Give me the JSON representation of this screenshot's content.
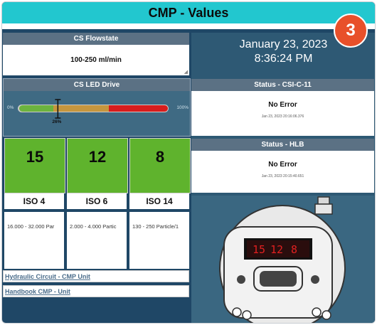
{
  "title": "CMP - Values",
  "badge": "3",
  "flowstate": {
    "header": "CS Flowstate",
    "value": "100-250 ml/min"
  },
  "led_drive": {
    "header": "CS LED Drive",
    "min_label": "0%",
    "max_label": "100%",
    "value_label": "26%",
    "value_fraction": 0.26
  },
  "datetime": {
    "date": "January 23, 2023",
    "time": "8:36:24 PM"
  },
  "status_csi": {
    "header": "Status - CSI-C-11",
    "value": "No Error",
    "timestamp": "Jan 23, 2023 20:16:06.376"
  },
  "status_hlb": {
    "header": "Status - HLB",
    "value": "No Error",
    "timestamp": "Jan 23, 2023 20:15:40.651"
  },
  "iso": [
    {
      "value": "15",
      "label": "ISO 4",
      "range": "16.000 - 32.000 Par"
    },
    {
      "value": "12",
      "label": "ISO 6",
      "range": "2.000 - 4.000 Partic"
    },
    {
      "value": "8",
      "label": "ISO 14",
      "range": "130 - 250 Particle/1"
    }
  ],
  "links": {
    "hydraulic": "Hydraulic Circuit - CMP Unit",
    "handbook": "Handbook CMP - Unit"
  },
  "device_display": [
    "15",
    "12",
    "8"
  ],
  "colors": {
    "title_bar": "#22c7cf",
    "badge": "#e8502a",
    "iso_green": "#5fb32d",
    "background": "#1f4766"
  }
}
